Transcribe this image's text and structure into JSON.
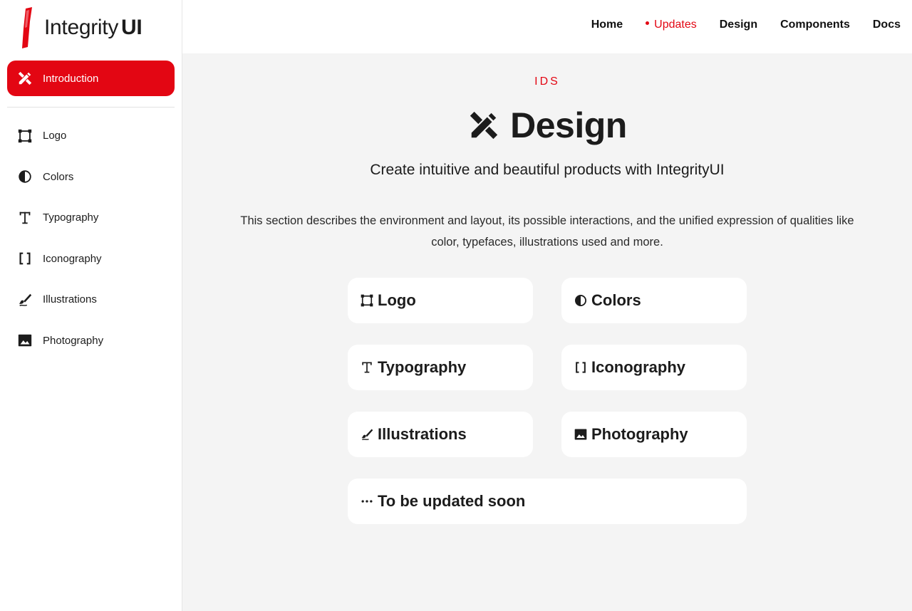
{
  "brand": {
    "name_light": "Integrity",
    "name_bold": "UI",
    "accent_color": "#e30613"
  },
  "sidebar": {
    "active": {
      "label": "Introduction",
      "icon": "design-tools-icon"
    },
    "items": [
      {
        "label": "Logo",
        "icon": "logo-frame-icon"
      },
      {
        "label": "Colors",
        "icon": "contrast-icon"
      },
      {
        "label": "Typography",
        "icon": "text-icon"
      },
      {
        "label": "Iconography",
        "icon": "brackets-icon"
      },
      {
        "label": "Illustrations",
        "icon": "brush-icon"
      },
      {
        "label": "Photography",
        "icon": "image-icon"
      }
    ]
  },
  "topnav": [
    {
      "label": "Home",
      "current": false
    },
    {
      "label": "Updates",
      "current": true
    },
    {
      "label": "Design",
      "current": false
    },
    {
      "label": "Components",
      "current": false
    },
    {
      "label": "Docs",
      "current": false
    }
  ],
  "main": {
    "eyebrow": "IDS",
    "title": "Design",
    "subtitle": "Create intuitive and beautiful products with IntegrityUI",
    "description": "This section describes the environment and layout, its possible interactions, and the unified expression of qualities like color, typefaces, illustrations used and more.",
    "cards": [
      {
        "label": "Logo",
        "icon": "logo-frame-icon"
      },
      {
        "label": "Colors",
        "icon": "contrast-icon"
      },
      {
        "label": "Typography",
        "icon": "text-icon"
      },
      {
        "label": "Iconography",
        "icon": "brackets-icon"
      },
      {
        "label": "Illustrations",
        "icon": "brush-icon"
      },
      {
        "label": "Photography",
        "icon": "image-icon"
      },
      {
        "label": "To be updated soon",
        "icon": "more-dots-icon"
      }
    ]
  }
}
